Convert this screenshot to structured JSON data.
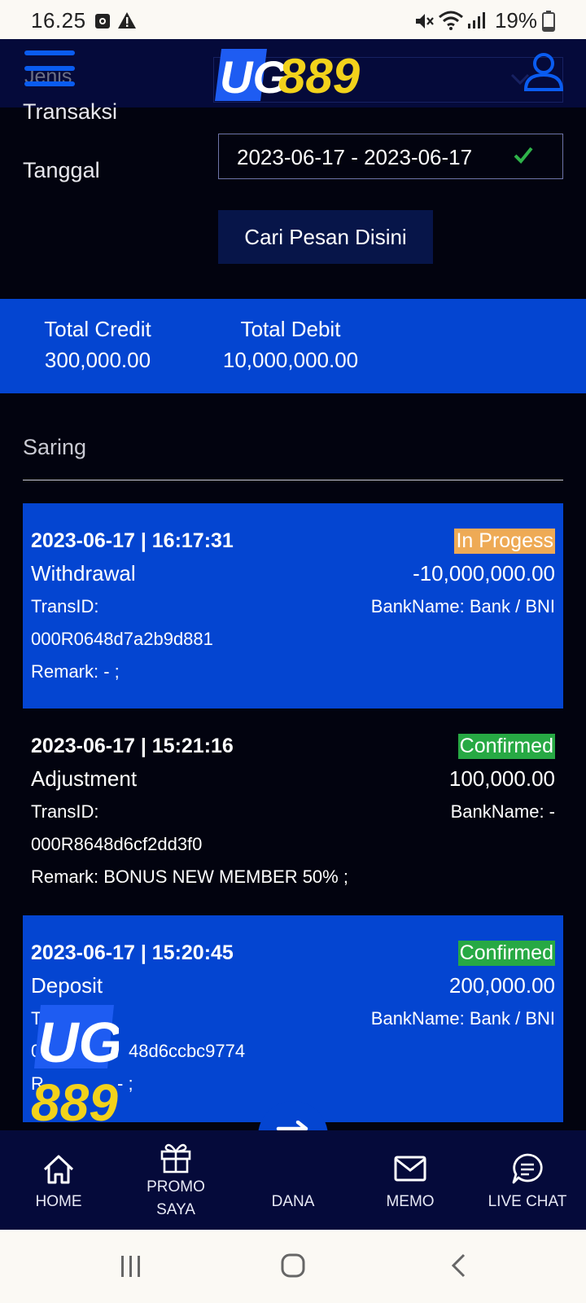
{
  "status_bar": {
    "time": "16.25",
    "battery": "19%"
  },
  "header": {
    "logo_text": "UG889",
    "ghost_label": "Jenis"
  },
  "filters": {
    "label_transaksi": "Transaksi",
    "label_tanggal": "Tanggal",
    "date_range": "2023-06-17 - 2023-06-17",
    "search_button": "Cari Pesan Disini"
  },
  "totals": {
    "credit_label": "Total Credit",
    "credit_value": "300,000.00",
    "debit_label": "Total Debit",
    "debit_value": "10,000,000.00"
  },
  "saring_label": "Saring",
  "transactions": [
    {
      "datetime": "2023-06-17 | 16:17:31",
      "status": "In Progess",
      "type": "Withdrawal",
      "amount": "-10,000,000.00",
      "trans_label": "TransID:",
      "trans_id": "000R0648d7a2b9d881",
      "bank": "BankName: Bank / BNI",
      "remark": "Remark: - ;"
    },
    {
      "datetime": "2023-06-17 | 15:21:16",
      "status": "Confirmed",
      "type": "Adjustment",
      "amount": "100,000.00",
      "trans_label": "TransID:",
      "trans_id": "000R8648d6cf2dd3f0",
      "bank": "BankName: -",
      "remark": "Remark: BONUS NEW MEMBER 50% ;"
    },
    {
      "datetime": "2023-06-17 | 15:20:45",
      "status": "Confirmed",
      "type": "Deposit",
      "amount": "200,000.00",
      "trans_label": "Tr",
      "trans_id": "0",
      "trans_id_tail": "48d6ccbc9774",
      "bank": "BankName: Bank / BNI",
      "remark": "R",
      "remark_tail": "- ;"
    }
  ],
  "watermark": {
    "top": "UG",
    "bottom": "889"
  },
  "bottom_nav": {
    "home": "HOME",
    "promo_line1": "PROMO",
    "promo_line2": "SAYA",
    "dana": "DANA",
    "memo": "MEMO",
    "live_chat": "LIVE CHAT"
  },
  "colors": {
    "background": "#02030f",
    "header": "#050a3a",
    "accent_blue": "#0445d1",
    "logo_yellow": "#f2d21b",
    "status_progress": "#eeaa55",
    "status_confirmed": "#27a944",
    "check_green": "#2fb34a"
  }
}
